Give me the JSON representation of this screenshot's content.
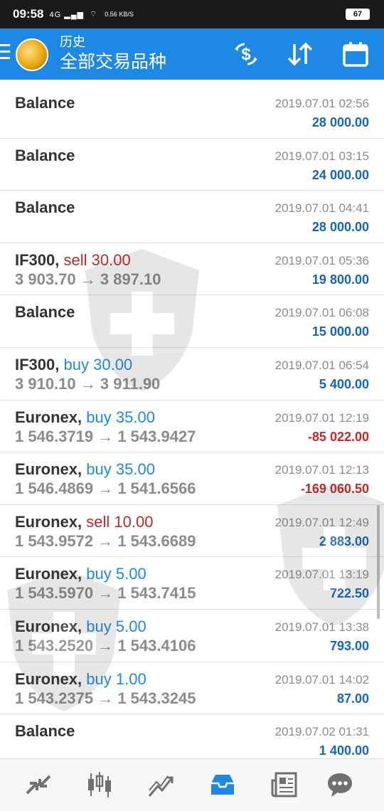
{
  "status_bar": {
    "time": "09:58",
    "signal": "4G",
    "net_speed": "0.56 KB/S",
    "battery": "67"
  },
  "app_bar": {
    "title": "历史",
    "subtitle": "全部交易品种",
    "icons": [
      "currency-exchange-icon",
      "sort-icon",
      "calendar-icon"
    ]
  },
  "rows": [
    {
      "symbol": "Balance",
      "op": "",
      "volume": "",
      "prices": "",
      "date": "2019.07.01 02:56",
      "profit": "28 000.00"
    },
    {
      "symbol": "Balance",
      "op": "",
      "volume": "",
      "prices": "",
      "date": "2019.07.01 03:15",
      "profit": "24 000.00"
    },
    {
      "symbol": "Balance",
      "op": "",
      "volume": "",
      "prices": "",
      "date": "2019.07.01 04:41",
      "profit": "28 000.00"
    },
    {
      "symbol": "IF300,",
      "op": "sell",
      "volume": "30.00",
      "prices": "3 903.70 → 3 897.10",
      "date": "2019.07.01 05:36",
      "profit": "19 800.00"
    },
    {
      "symbol": "Balance",
      "op": "",
      "volume": "",
      "prices": "",
      "date": "2019.07.01 06:08",
      "profit": "15 000.00"
    },
    {
      "symbol": "IF300,",
      "op": "buy",
      "volume": "30.00",
      "prices": "3 910.10 → 3 911.90",
      "date": "2019.07.01 06:54",
      "profit": "5 400.00"
    },
    {
      "symbol": "Euronex,",
      "op": "buy",
      "volume": "35.00",
      "prices": "1 546.3719 → 1 543.9427",
      "date": "2019.07.01 12:19",
      "profit": "-85 022.00"
    },
    {
      "symbol": "Euronex,",
      "op": "buy",
      "volume": "35.00",
      "prices": "1 546.4869 → 1 541.6566",
      "date": "2019.07.01 12:13",
      "profit": "-169 060.50"
    },
    {
      "symbol": "Euronex,",
      "op": "sell",
      "volume": "10.00",
      "prices": "1 543.9572 → 1 543.6689",
      "date": "2019.07.01 12:49",
      "profit": "2 883.00"
    },
    {
      "symbol": "Euronex,",
      "op": "buy",
      "volume": "5.00",
      "prices": "1 543.5970 → 1 543.7415",
      "date": "2019.07.01 13:19",
      "profit": "722.50"
    },
    {
      "symbol": "Euronex,",
      "op": "buy",
      "volume": "5.00",
      "prices": "1 543.2520 → 1 543.4106",
      "date": "2019.07.01 13:38",
      "profit": "793.00"
    },
    {
      "symbol": "Euronex,",
      "op": "buy",
      "volume": "1.00",
      "prices": "1 543.2375 → 1 543.3245",
      "date": "2019.07.01 14:02",
      "profit": "87.00"
    },
    {
      "symbol": "Balance",
      "op": "",
      "volume": "",
      "prices": "",
      "date": "2019.07.02 01:31",
      "profit": "1 400.00"
    }
  ],
  "bottom_nav": {
    "items": [
      "quotes-icon",
      "chart-icon",
      "trade-icon",
      "history-icon",
      "news-icon",
      "chat-icon"
    ],
    "active": "history-icon",
    "active_color": "#1e88e5",
    "inactive_color": "#707070"
  },
  "colors": {
    "primary": "#1e88e5",
    "buy": "#1e88e5",
    "sell": "#c62828",
    "profit_positive": "#1565c0",
    "profit_negative": "#c62828"
  }
}
